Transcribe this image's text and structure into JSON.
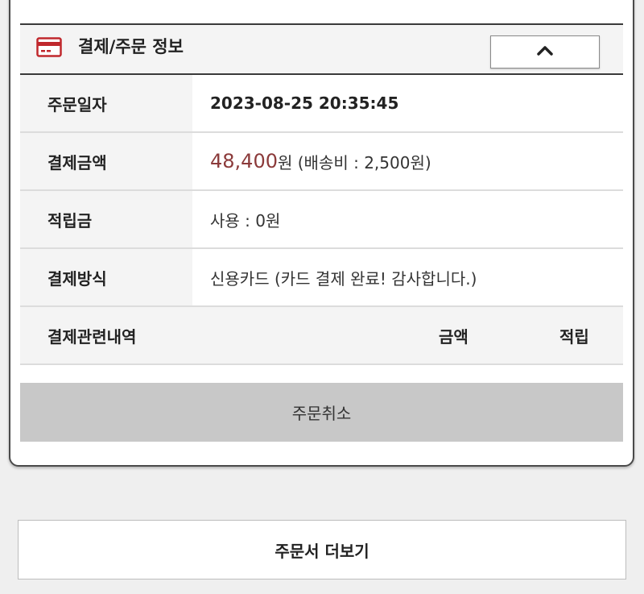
{
  "section": {
    "title": "결제/주문 정보",
    "icon": "credit-card-icon",
    "collapse_icon": "chevron-up-icon",
    "accent_color": "#c0282d"
  },
  "rows": {
    "order_date": {
      "label": "주문일자",
      "value": "2023-08-25 20:35:45"
    },
    "payment_amount": {
      "label": "결제금액",
      "amount": "48,400",
      "unit": "원",
      "shipping": " (배송비 : 2,500원)",
      "amount_color": "#8b3a3a"
    },
    "points": {
      "label": "적립금",
      "value": "사용 : 0원"
    },
    "payment_method": {
      "label": "결제방식",
      "value": "신용카드 (카드 결제 완료! 감사합니다.)"
    }
  },
  "history": {
    "label": "결제관련내역",
    "col_amount": "금액",
    "col_points": "적립"
  },
  "cancel_label": "주문취소",
  "more_label": "주문서 더보기"
}
